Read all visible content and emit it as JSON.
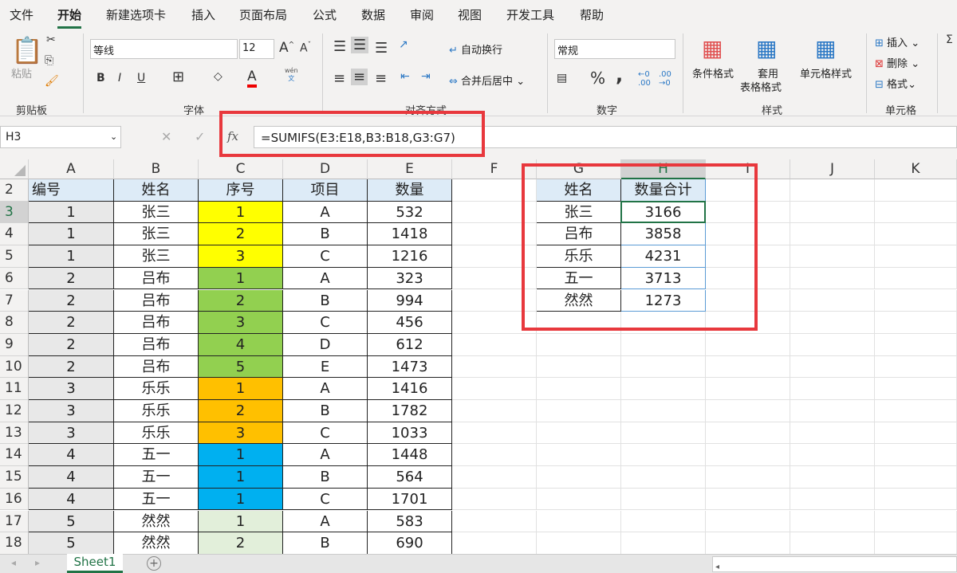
{
  "menu": [
    "文件",
    "开始",
    "新建选项卡",
    "插入",
    "页面布局",
    "公式",
    "数据",
    "审阅",
    "视图",
    "开发工具",
    "帮助"
  ],
  "ribbon": {
    "clipboard": {
      "paste": "粘贴",
      "group": "剪贴板"
    },
    "font": {
      "name": "等线",
      "size": "12",
      "group": "字体",
      "bold": "B",
      "italic": "I",
      "underline": "U",
      "phonetic_top": "wén",
      "phonetic_bottom": "文"
    },
    "align": {
      "wrap": "自动换行",
      "merge": "合并后居中",
      "group": "对齐方式"
    },
    "number": {
      "format": "常规",
      "group": "数字",
      "percent": "%",
      "comma": ","
    },
    "styles": {
      "conditional": "条件格式",
      "table1": "套用",
      "table2": "表格格式",
      "cell_styles": "单元格样式",
      "group": "样式"
    },
    "cells": {
      "insert": "插入",
      "delete": "删除",
      "format": "格式",
      "group": "单元格"
    }
  },
  "formula_bar": {
    "name_box": "H3",
    "fx": "fx",
    "formula": "=SUMIFS(E3:E18,B3:B18,G3:G7)"
  },
  "columns": [
    "A",
    "B",
    "C",
    "D",
    "E",
    "F",
    "G",
    "H",
    "I",
    "J",
    "K"
  ],
  "rows": [
    "2",
    "3",
    "4",
    "5",
    "6",
    "7",
    "8",
    "9",
    "10",
    "11",
    "12",
    "13",
    "14",
    "15",
    "16",
    "17",
    "18"
  ],
  "table": {
    "headers": [
      "编号",
      "姓名",
      "序号",
      "项目",
      "数量"
    ],
    "rows": [
      [
        "1",
        "张三",
        "1",
        "A",
        "532"
      ],
      [
        "1",
        "张三",
        "2",
        "B",
        "1418"
      ],
      [
        "1",
        "张三",
        "3",
        "C",
        "1216"
      ],
      [
        "2",
        "吕布",
        "1",
        "A",
        "323"
      ],
      [
        "2",
        "吕布",
        "2",
        "B",
        "994"
      ],
      [
        "2",
        "吕布",
        "3",
        "C",
        "456"
      ],
      [
        "2",
        "吕布",
        "4",
        "D",
        "612"
      ],
      [
        "2",
        "吕布",
        "5",
        "E",
        "1473"
      ],
      [
        "3",
        "乐乐",
        "1",
        "A",
        "1416"
      ],
      [
        "3",
        "乐乐",
        "2",
        "B",
        "1782"
      ],
      [
        "3",
        "乐乐",
        "3",
        "C",
        "1033"
      ],
      [
        "4",
        "五一",
        "1",
        "A",
        "1448"
      ],
      [
        "4",
        "五一",
        "1",
        "B",
        "564"
      ],
      [
        "4",
        "五一",
        "1",
        "C",
        "1701"
      ],
      [
        "5",
        "然然",
        "1",
        "A",
        "583"
      ],
      [
        "5",
        "然然",
        "2",
        "B",
        "690"
      ]
    ],
    "seq_colors": [
      "#ffff00",
      "#ffff00",
      "#ffff00",
      "#92d050",
      "#92d050",
      "#92d050",
      "#92d050",
      "#92d050",
      "#ffc000",
      "#ffc000",
      "#ffc000",
      "#00b0f0",
      "#00b0f0",
      "#00b0f0",
      "#e2efda",
      "#e2efda"
    ]
  },
  "summary": {
    "headers": [
      "姓名",
      "数量合计"
    ],
    "rows": [
      [
        "张三",
        "3166"
      ],
      [
        "吕布",
        "3858"
      ],
      [
        "乐乐",
        "4231"
      ],
      [
        "五一",
        "3713"
      ],
      [
        "然然",
        "1273"
      ]
    ]
  },
  "sheet_tabs": {
    "active": "Sheet1",
    "add": "+"
  },
  "colors": {
    "accent": "#217346",
    "header_fill": "#ddebf7",
    "highlight": "#e8383d"
  }
}
